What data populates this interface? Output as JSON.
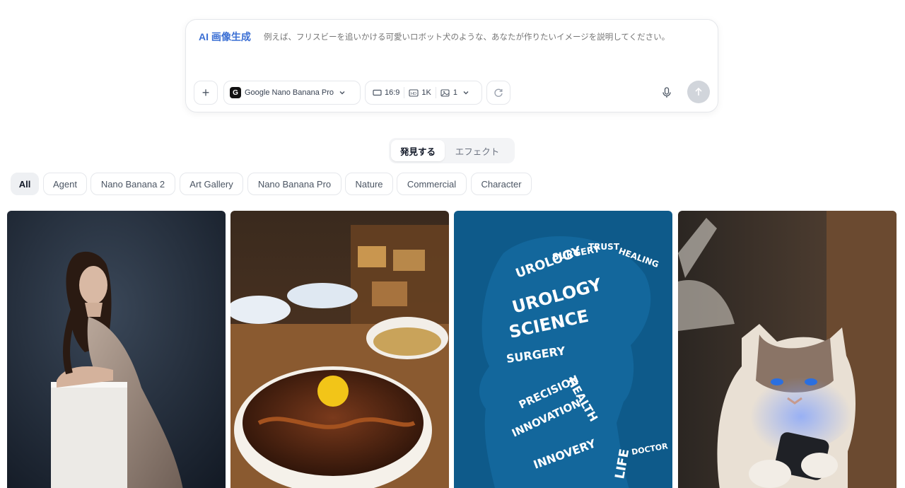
{
  "prompt": {
    "label": "AI 画像生成",
    "placeholder": "例えば、フリスビーを追いかける可愛いロボット犬のような、あなたが作りたいイメージを説明してください。"
  },
  "controls": {
    "add_icon": "plus-icon",
    "model": "Google Nano Banana Pro",
    "model_logo": "G",
    "aspect": "16:9",
    "resolution": "1K",
    "count": "1",
    "refresh_icon": "refresh-icon",
    "mic_icon": "microphone-icon",
    "send_icon": "arrow-up-icon"
  },
  "tabs": [
    "発見する",
    "エフェクト"
  ],
  "chips": [
    "All",
    "Agent",
    "Nano Banana 2",
    "Art Gallery",
    "Nano Banana Pro",
    "Nature",
    "Commercial",
    "Character"
  ],
  "gallery": [
    {
      "name": "woman-portrait"
    },
    {
      "name": "beef-rice-bowl"
    },
    {
      "name": "urology-typography",
      "words": [
        "UROLOGY",
        "SURGERY",
        "TRUST",
        "HEALING",
        "SCIENCE",
        "HEALTH",
        "PRECISION",
        "INNOVATION",
        "INNOVERY",
        "LIFE",
        "DOCTOR"
      ]
    },
    {
      "name": "cat-phone"
    }
  ],
  "colors": {
    "accent": "#3b6fd4",
    "send_disabled": "#d1d5db",
    "chip_active": "#eef0f3"
  }
}
